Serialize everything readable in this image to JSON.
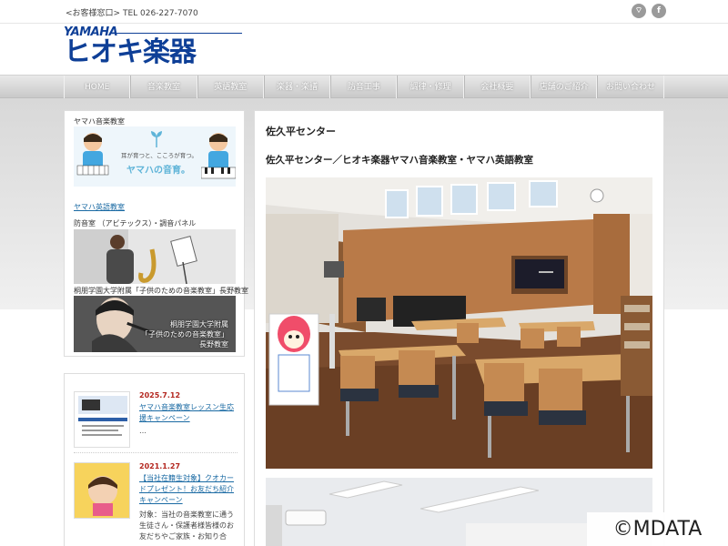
{
  "header": {
    "contact": "<お客様窓口> TEL 026-227-7070",
    "logo_top": "YAMAHA",
    "logo_name": "ヒオキ楽器",
    "social": [
      {
        "icon": "rss-icon",
        "glyph": "⌔"
      },
      {
        "icon": "facebook-icon",
        "glyph": "f"
      }
    ]
  },
  "nav": {
    "items": [
      "HOME",
      "音楽教室",
      "英語教室",
      "楽器・楽譜",
      "防音工事",
      "調律・修理",
      "会社概要",
      "店舗のご紹介",
      "お問い合わせ"
    ]
  },
  "sidebar": {
    "music_class_label": "ヤマハ音楽教室",
    "banner_text1": "耳が育つと、こころが育つ。",
    "banner_text2": "ヤマハの音育。",
    "english_class_link": "ヤマハ英語教室",
    "soundproof_label": "防音室 （アビテックス）・調音パネル",
    "toho_label": "桐朋学園大学附属「子供のための音楽教室」長野教室",
    "toho_caption": [
      "桐朋学園大学附属",
      "「子供のための音楽教室」",
      "長野教室"
    ]
  },
  "news": [
    {
      "date": "2025.7.12",
      "title": "ヤマハ音楽教室レッスン生応援キャンペーン",
      "body": "…"
    },
    {
      "date": "2021.1.27",
      "title": "【当社在籍生対象】クオカードプレゼント！お友だち紹介キャンペーン",
      "body": "対象：当社の音楽教室に通う生徒さん・保護者様皆様のお友だちやご家族・お知り合"
    }
  ],
  "main": {
    "title": "佐久平センター",
    "subtitle": "佐久平センター／ヒオキ楽器ヤマハ音楽教室・ヤマハ英語教室"
  },
  "watermark": "©MDATA"
}
